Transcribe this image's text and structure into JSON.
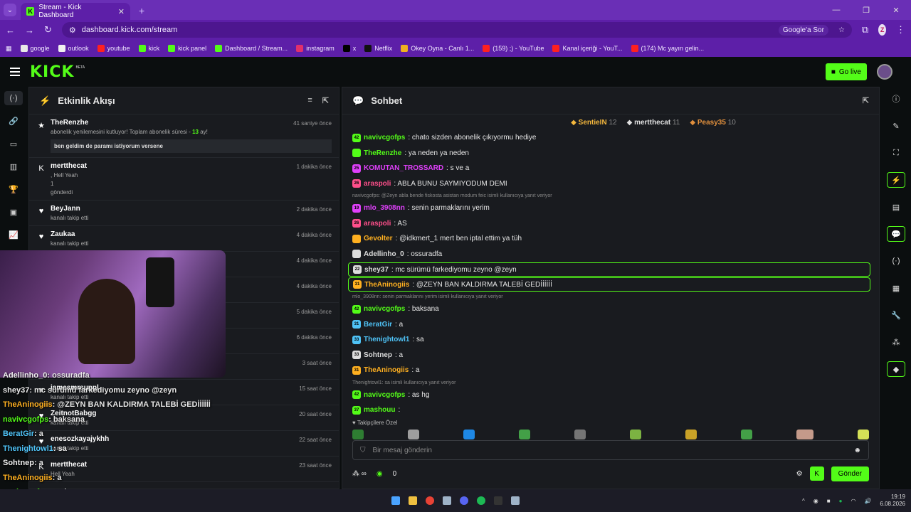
{
  "browser": {
    "tab_title": "Stream - Kick Dashboard",
    "url": "dashboard.kick.com/stream",
    "search_prompt": "Google'a Sor",
    "profile_letter": "Z",
    "bookmarks": [
      {
        "label": "google",
        "color": "#e8e8e8"
      },
      {
        "label": "outlook",
        "color": "#f0f0f0"
      },
      {
        "label": "youtube",
        "color": "#ff2020"
      },
      {
        "label": "kick",
        "color": "#53fc18"
      },
      {
        "label": "kick panel",
        "color": "#53fc18"
      },
      {
        "label": "Dashboard / Stream...",
        "color": "#53fc18"
      },
      {
        "label": "instagram",
        "color": "#e1306c"
      },
      {
        "label": "x",
        "color": "#000000"
      },
      {
        "label": "Netflix",
        "color": "#111111"
      },
      {
        "label": "Okey Oyna - Canlı 1...",
        "color": "#f0b020"
      },
      {
        "label": "(159) ;) - YouTube",
        "color": "#ff2020"
      },
      {
        "label": "Kanal içeriği - YouT...",
        "color": "#ff2020"
      },
      {
        "label": "(174) Mc yayın gelin...",
        "color": "#ff2020"
      }
    ]
  },
  "header": {
    "logo": "KICK",
    "beta": "BETA",
    "go_live": "Go live"
  },
  "activity": {
    "title": "Etkinlik Akışı",
    "events": [
      {
        "name": "TheRenzhe",
        "time": "41 saniye önce",
        "sub_text": "abonelik yenilemesini kutluyor! Toplam abonelik süresi - ",
        "sub_count": "13",
        "sub_tail": " ay!",
        "message": "ben geldim de paramı istiyorum versene"
      },
      {
        "name": "mertthecat",
        "time": "1 dakika önce",
        "line1": ", Hell Yeah",
        "line2": "1",
        "line3": "gönderdi"
      },
      {
        "name": "BeyJann",
        "time": "2 dakika önce",
        "action": "kanalı takip etti"
      },
      {
        "name": "Zaukaa",
        "time": "4 dakika önce",
        "action": "kanalı takip etti"
      },
      {
        "name": "",
        "time": "4 dakika önce",
        "action": ""
      },
      {
        "name": "",
        "time": "4 dakika önce",
        "action": ""
      },
      {
        "name": "",
        "time": "5 dakika önce",
        "action": ""
      },
      {
        "name": "",
        "time": "6 dakika önce",
        "action": ""
      },
      {
        "name": "",
        "time": "3 saat önce",
        "action": ""
      },
      {
        "name": "jamesmrsuppl",
        "time": "15 saat önce",
        "action": "kanalı takip etti"
      },
      {
        "name": "ZeitnotBabgg",
        "time": "20 saat önce",
        "action": "kanalı takip etti"
      },
      {
        "name": "enesozkayajykhh",
        "time": "22 saat önce",
        "action": "kanalı takip etti"
      },
      {
        "name": "mertthecat",
        "time": "23 saat önce",
        "action": "Hell Yeah"
      }
    ]
  },
  "chat": {
    "title": "Sohbet",
    "leaderboard": [
      {
        "name": "SentieIN",
        "count": "12",
        "color": "#f5b83d"
      },
      {
        "name": "mertthecat",
        "count": "11",
        "color": "#e0e0e0"
      },
      {
        "name": "Peasy35",
        "count": "10",
        "color": "#e08f3d"
      }
    ],
    "messages": [
      {
        "badge": "42",
        "user": "navivcgofps",
        "color": "#53fc18",
        "text": ": chato sizden abonelik çıkıyormu hediye"
      },
      {
        "badge": "",
        "user": "TheRenzhe",
        "color": "#53fc18",
        "text": ": ya neden ya neden"
      },
      {
        "badge": "25",
        "user": "KOMUTAN_TROSSARD",
        "color": "#e040fb",
        "text": ": s ve a"
      },
      {
        "badge": "26",
        "user": "araspoli",
        "color": "#ff4f8b",
        "text": ": ABLA BUNU SAYMIYODUM DEMI"
      },
      {
        "reply": "navivcgofps: @Zeyn abla bende fiskosta asistan modum feic isimli kullanıcıya yanıt veriyor"
      },
      {
        "badge": "19",
        "user": "mlo_3908nn",
        "color": "#e040fb",
        "text": ": senin parmaklarını yerim"
      },
      {
        "badge": "26",
        "user": "araspoli",
        "color": "#ff4f8b",
        "text": ": AS"
      },
      {
        "badge": "",
        "user": "Gevolter",
        "color": "#ffb020",
        "text": ": @idkmert_1 mert ben iptal ettim ya tüh"
      },
      {
        "badge": "",
        "user": "Adellinho_0",
        "color": "#dddddd",
        "text": ": ossuradfa"
      },
      {
        "badge": "22",
        "user": "shey37",
        "color": "#dddddd",
        "text": ": mc sürümü farkediyomu zeyno @zeyn",
        "boxed": true
      },
      {
        "badge": "31",
        "user": "TheAninogiis",
        "color": "#ffb020",
        "text": ": @ZEYN BAN KALDIRMA TALEBİ GEDİİİİİİ",
        "boxed": true
      },
      {
        "reply": "mlo_3908nn: senin parmaklarını yerim isimli kullanıcıya yanıt veriyor"
      },
      {
        "badge": "42",
        "user": "navivcgofps",
        "color": "#53fc18",
        "text": ": baksana"
      },
      {
        "badge": "31",
        "user": "BeratGir",
        "color": "#4fc3f7",
        "text": ": a"
      },
      {
        "badge": "33",
        "user": "Thenightowl1",
        "color": "#4fc3f7",
        "text": ": sa"
      },
      {
        "badge": "33",
        "user": "Sohtnep",
        "color": "#dddddd",
        "text": ": a"
      },
      {
        "badge": "31",
        "user": "TheAninogiis",
        "color": "#ffb020",
        "text": ": a"
      },
      {
        "reply": "Thenightowl1: sa isimli kullanıcıya yanıt veriyor"
      },
      {
        "badge": "42",
        "user": "navivcgofps",
        "color": "#53fc18",
        "text": ": as hg"
      },
      {
        "badge": "37",
        "user": "mashouu",
        "color": "#53fc18",
        "text": ":"
      }
    ],
    "followers_only": "Takipçilere Özel",
    "input_placeholder": "Bir mesaj gönderin",
    "points_count": "0",
    "send_label": "Gönder"
  },
  "overlay_chat": [
    {
      "user": "Adellinho_0",
      "text": ": ossuradfa",
      "color": "#eeeeee"
    },
    {
      "user": "shey37",
      "text": ": mc sürümü farkediyomu zeyno @zeyn",
      "color": "#eeeeee"
    },
    {
      "user": "TheAninogiis",
      "text": ": @ZEYN BAN KALDIRMA TALEBİ GEDİİİİİİ",
      "color": "#ffb020"
    },
    {
      "user": "navivcgofps",
      "text": ": baksana",
      "color": "#53fc18"
    },
    {
      "user": "BeratGir",
      "text": ": a",
      "color": "#4fc3f7"
    },
    {
      "user": "Thenightowl1",
      "text": ": sa",
      "color": "#4fc3f7"
    },
    {
      "user": "Sohtnep",
      "text": ": a",
      "color": "#eeeeee"
    },
    {
      "user": "TheAninogiis",
      "text": ": a",
      "color": "#ffb020"
    },
    {
      "user": "navivcgofps",
      "text": ": as hg",
      "color": "#53fc18"
    }
  ],
  "taskbar": {
    "time": "19:19",
    "date": "6.08.2026"
  }
}
